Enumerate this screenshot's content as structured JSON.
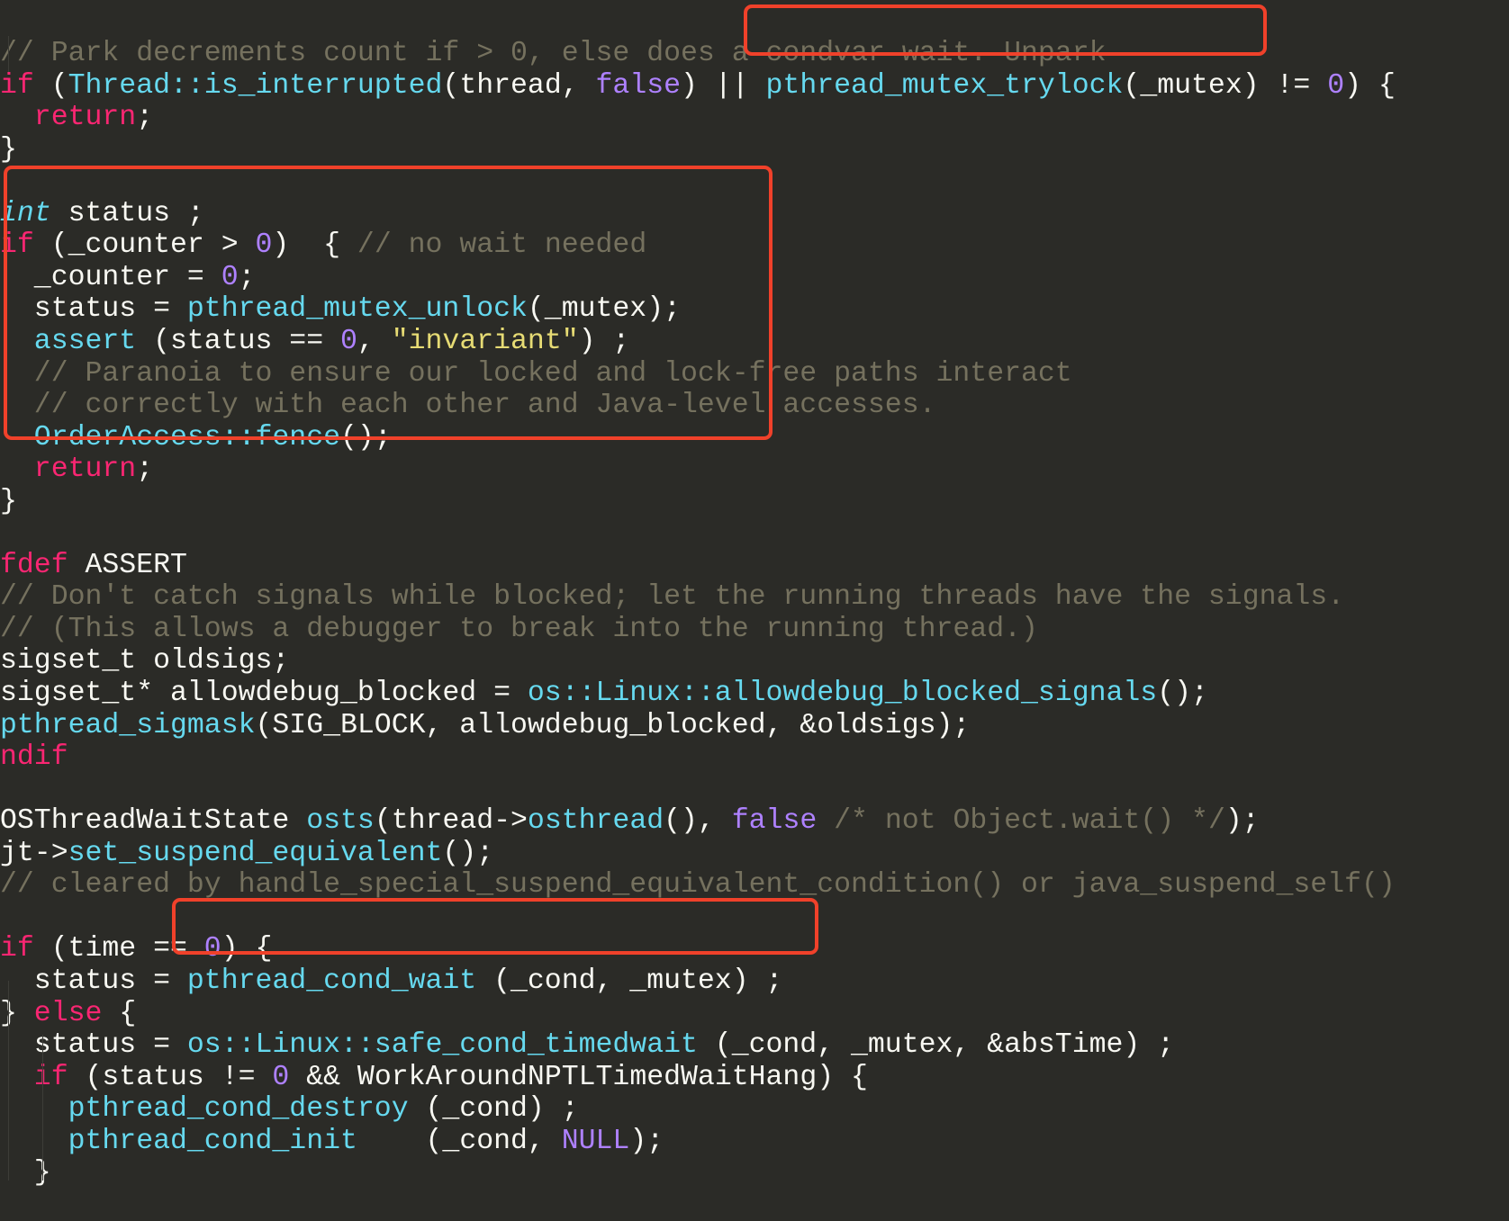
{
  "editor": {
    "theme_colors": {
      "background": "#2b2b27",
      "keyword": "#f92672",
      "function": "#66d9ef",
      "number": "#ae81ff",
      "string": "#e6db74",
      "comment": "#75715e",
      "plain": "#f8f8f2",
      "highlight_box": "#f0412a"
    },
    "lines": [
      [
        {
          "t": "cm",
          "v": "// Park decrements count if > 0, else does a condvar wait. Unpark"
        }
      ],
      [
        {
          "t": "kw",
          "v": "if"
        },
        {
          "t": "pl",
          "v": " ("
        },
        {
          "t": "fn",
          "v": "Thread::is_interrupted"
        },
        {
          "t": "pl",
          "v": "(thread, "
        },
        {
          "t": "num",
          "v": "false"
        },
        {
          "t": "pl",
          "v": ") || "
        },
        {
          "t": "fn",
          "v": "pthread_mutex_trylock"
        },
        {
          "t": "pl",
          "v": "(_mutex) != "
        },
        {
          "t": "num",
          "v": "0"
        },
        {
          "t": "pl",
          "v": ") {"
        }
      ],
      [
        {
          "t": "pl",
          "v": "  "
        },
        {
          "t": "kw",
          "v": "return"
        },
        {
          "t": "pl",
          "v": ";"
        }
      ],
      [
        {
          "t": "pl",
          "v": "}"
        }
      ],
      [],
      [
        {
          "t": "type",
          "v": "int"
        },
        {
          "t": "pl",
          "v": " status ;"
        }
      ],
      [
        {
          "t": "kw",
          "v": "if"
        },
        {
          "t": "pl",
          "v": " (_counter > "
        },
        {
          "t": "num",
          "v": "0"
        },
        {
          "t": "pl",
          "v": ")  { "
        },
        {
          "t": "cm",
          "v": "// no wait needed"
        }
      ],
      [
        {
          "t": "pl",
          "v": "  _counter = "
        },
        {
          "t": "num",
          "v": "0"
        },
        {
          "t": "pl",
          "v": ";"
        }
      ],
      [
        {
          "t": "pl",
          "v": "  status = "
        },
        {
          "t": "fn",
          "v": "pthread_mutex_unlock"
        },
        {
          "t": "pl",
          "v": "(_mutex);"
        }
      ],
      [
        {
          "t": "pl",
          "v": "  "
        },
        {
          "t": "fn",
          "v": "assert"
        },
        {
          "t": "pl",
          "v": " (status == "
        },
        {
          "t": "num",
          "v": "0"
        },
        {
          "t": "pl",
          "v": ", "
        },
        {
          "t": "str",
          "v": "\"invariant\""
        },
        {
          "t": "pl",
          "v": ") ;"
        }
      ],
      [
        {
          "t": "pl",
          "v": "  "
        },
        {
          "t": "cm",
          "v": "// Paranoia to ensure our locked and lock-free paths interact"
        }
      ],
      [
        {
          "t": "pl",
          "v": "  "
        },
        {
          "t": "cm",
          "v": "// correctly with each other and Java-level accesses."
        }
      ],
      [
        {
          "t": "pl",
          "v": "  "
        },
        {
          "t": "fn",
          "v": "OrderAccess::fence"
        },
        {
          "t": "pl",
          "v": "();"
        }
      ],
      [
        {
          "t": "pl",
          "v": "  "
        },
        {
          "t": "kw",
          "v": "return"
        },
        {
          "t": "pl",
          "v": ";"
        }
      ],
      [
        {
          "t": "pl",
          "v": "}"
        }
      ],
      [],
      [
        {
          "t": "kw",
          "v": "fdef"
        },
        {
          "t": "pl",
          "v": " ASSERT"
        }
      ],
      [
        {
          "t": "cm",
          "v": "// Don't catch signals while blocked; let the running threads have the signals."
        }
      ],
      [
        {
          "t": "cm",
          "v": "// (This allows a debugger to break into the running thread.)"
        }
      ],
      [
        {
          "t": "pl",
          "v": "sigset_t oldsigs;"
        }
      ],
      [
        {
          "t": "pl",
          "v": "sigset_t* allowdebug_blocked = "
        },
        {
          "t": "fn",
          "v": "os::Linux::allowdebug_blocked_signals"
        },
        {
          "t": "pl",
          "v": "();"
        }
      ],
      [
        {
          "t": "fn",
          "v": "pthread_sigmask"
        },
        {
          "t": "pl",
          "v": "(SIG_BLOCK, allowdebug_blocked, &oldsigs);"
        }
      ],
      [
        {
          "t": "kw",
          "v": "ndif"
        }
      ],
      [],
      [
        {
          "t": "pl",
          "v": "OSThreadWaitState "
        },
        {
          "t": "fn",
          "v": "osts"
        },
        {
          "t": "pl",
          "v": "(thread->"
        },
        {
          "t": "fn",
          "v": "osthread"
        },
        {
          "t": "pl",
          "v": "(), "
        },
        {
          "t": "num",
          "v": "false"
        },
        {
          "t": "pl",
          "v": " "
        },
        {
          "t": "cm",
          "v": "/* not Object.wait() */"
        },
        {
          "t": "pl",
          "v": ");"
        }
      ],
      [
        {
          "t": "pl",
          "v": "jt->"
        },
        {
          "t": "fn",
          "v": "set_suspend_equivalent"
        },
        {
          "t": "pl",
          "v": "();"
        }
      ],
      [
        {
          "t": "cm",
          "v": "// cleared by handle_special_suspend_equivalent_condition() or java_suspend_self()"
        }
      ],
      [],
      [
        {
          "t": "kw",
          "v": "if"
        },
        {
          "t": "pl",
          "v": " (time == "
        },
        {
          "t": "num",
          "v": "0"
        },
        {
          "t": "pl",
          "v": ") {"
        }
      ],
      [
        {
          "t": "pl",
          "v": "  status = "
        },
        {
          "t": "fn",
          "v": "pthread_cond_wait"
        },
        {
          "t": "pl",
          "v": " (_cond, _mutex) ;"
        }
      ],
      [
        {
          "t": "pl",
          "v": "} "
        },
        {
          "t": "kw",
          "v": "else"
        },
        {
          "t": "pl",
          "v": " {"
        }
      ],
      [
        {
          "t": "pl",
          "v": "  status = "
        },
        {
          "t": "fn",
          "v": "os::Linux::safe_cond_timedwait"
        },
        {
          "t": "pl",
          "v": " (_cond, _mutex, &absTime) ;"
        }
      ],
      [
        {
          "t": "pl",
          "v": "  "
        },
        {
          "t": "kw",
          "v": "if"
        },
        {
          "t": "pl",
          "v": " (status != "
        },
        {
          "t": "num",
          "v": "0"
        },
        {
          "t": "pl",
          "v": " && WorkAroundNPTLTimedWaitHang) {"
        }
      ],
      [
        {
          "t": "pl",
          "v": "    "
        },
        {
          "t": "fn",
          "v": "pthread_cond_destroy"
        },
        {
          "t": "pl",
          "v": " (_cond) ;"
        }
      ],
      [
        {
          "t": "pl",
          "v": "    "
        },
        {
          "t": "fn",
          "v": "pthread_cond_init"
        },
        {
          "t": "pl",
          "v": "    (_cond, "
        },
        {
          "t": "num",
          "v": "NULL"
        },
        {
          "t": "pl",
          "v": ");"
        }
      ],
      [
        {
          "t": "pl",
          "v": "  }"
        }
      ]
    ],
    "highlights": [
      {
        "name": "highlight-trylock",
        "label": "pthread_mutex_trylock(_mutex)"
      },
      {
        "name": "highlight-counter-block",
        "label": "if (_counter > 0) block"
      },
      {
        "name": "highlight-cond-wait",
        "label": "pthread_cond_wait (_cond, _mutex) ;"
      }
    ]
  }
}
